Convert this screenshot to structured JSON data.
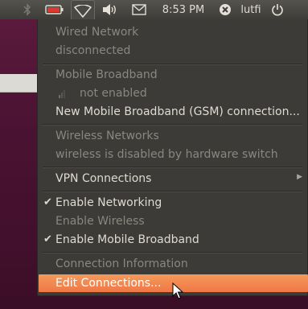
{
  "panel": {
    "clock": "8:53 PM",
    "username": "lutfi",
    "icons": [
      "bluetooth-icon",
      "battery-icon",
      "network-icon",
      "volume-icon",
      "mail-icon",
      "user-status-icon",
      "power-icon"
    ]
  },
  "menu": {
    "wired_header": "Wired Network",
    "wired_status": "disconnected",
    "mobile_header": "Mobile Broadband",
    "mobile_status": "not enabled",
    "mobile_new": "New Mobile Broadband (GSM) connection...",
    "wireless_header": "Wireless Networks",
    "wireless_status": "wireless is disabled by hardware switch",
    "vpn": "VPN Connections",
    "enable_networking": "Enable Networking",
    "enable_wireless": "Enable Wireless",
    "enable_mobile": "Enable Mobile Broadband",
    "connection_info": "Connection Information",
    "edit_connections": "Edit Connections..."
  },
  "colors": {
    "panel_bg": "#3e3d39",
    "menu_bg": "#3c3b37",
    "highlight": "#f07746",
    "battery": "#df382c"
  }
}
